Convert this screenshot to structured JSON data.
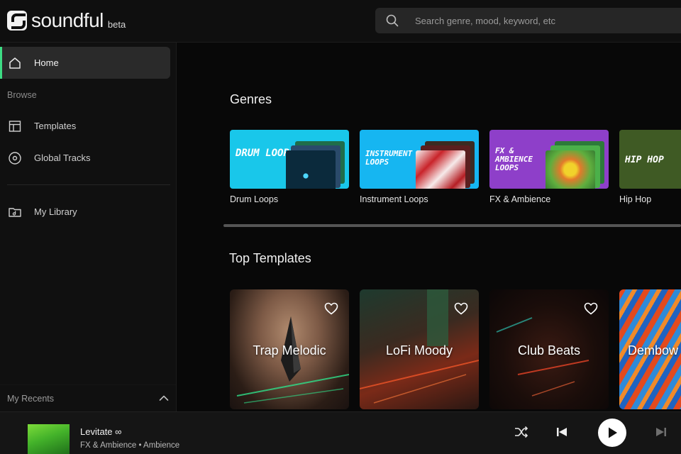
{
  "app": {
    "logo_text": "soundful",
    "logo_badge": "beta"
  },
  "search": {
    "placeholder": "Search genre, mood, keyword, etc",
    "icon": "search-icon"
  },
  "sidebar": {
    "home_label": "Home",
    "browse_label": "Browse",
    "items": [
      {
        "label": "Templates",
        "icon": "templates-icon"
      },
      {
        "label": "Global Tracks",
        "icon": "disc-icon"
      },
      {
        "label": "My Library",
        "icon": "library-icon"
      }
    ],
    "recents_label": "My Recents"
  },
  "main": {
    "genres_heading": "Genres",
    "genres": [
      {
        "label": "Drum Loops",
        "art_text": "DRUM LOOPS",
        "color": "#19c7ea"
      },
      {
        "label": "Instrument Loops",
        "art_text": "INSTRUMENT LOOPS",
        "color": "#16b6f1"
      },
      {
        "label": "FX & Ambience",
        "art_text": "FX & AMBIENCE LOOPS",
        "color": "#8e3fc9"
      },
      {
        "label": "Hip Hop",
        "art_text": "HIP HOP",
        "color": "#3f5a24"
      }
    ],
    "templates_heading": "Top Templates",
    "templates": [
      {
        "label": "Trap Melodic"
      },
      {
        "label": "LoFi Moody"
      },
      {
        "label": "Club Beats"
      },
      {
        "label": "Dembow"
      }
    ]
  },
  "player": {
    "title": "Levitate ∞",
    "subtitle": "FX & Ambience • Ambience"
  },
  "colors": {
    "accent": "#3ddc84",
    "background": "#0b0b0b"
  }
}
